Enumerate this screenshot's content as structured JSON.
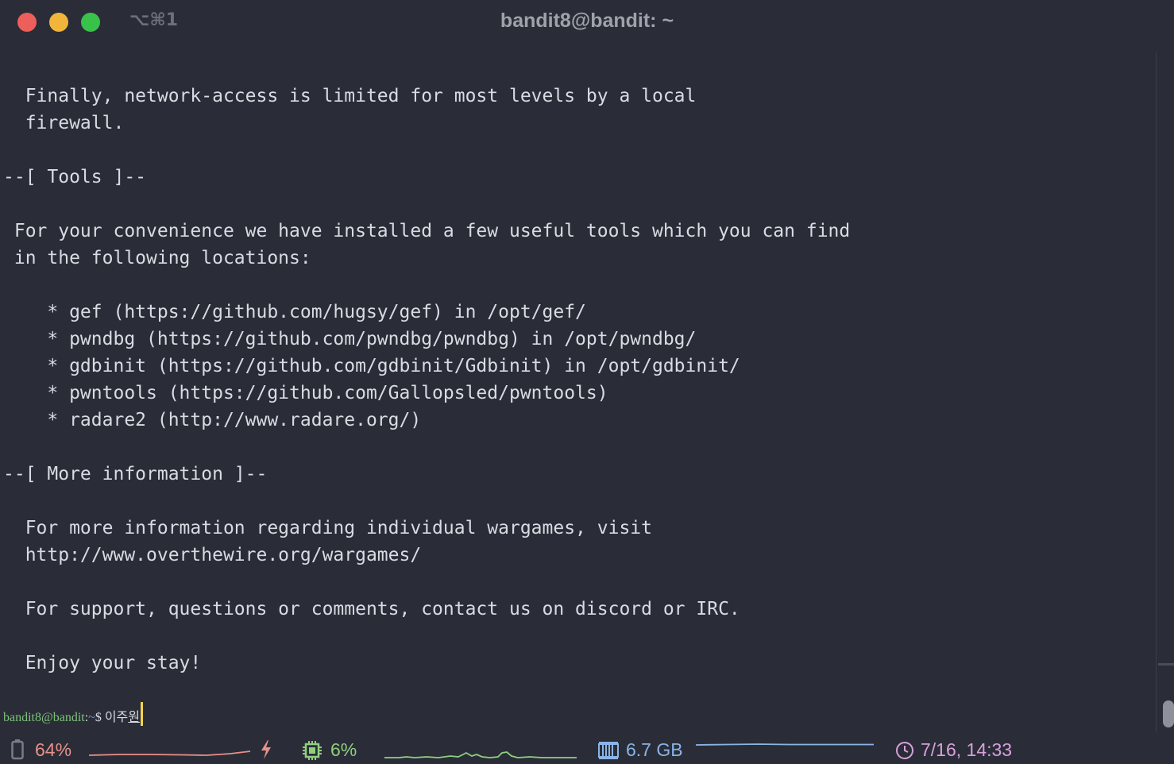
{
  "window": {
    "shortcut": "⌥⌘1",
    "title": "bandit8@bandit: ~"
  },
  "terminal": {
    "lines": [
      "",
      "  Finally, network-access is limited for most levels by a local",
      "  firewall.",
      "",
      "--[ Tools ]--",
      "",
      " For your convenience we have installed a few useful tools which you can find",
      " in the following locations:",
      "",
      "    * gef (https://github.com/hugsy/gef) in /opt/gef/",
      "    * pwndbg (https://github.com/pwndbg/pwndbg) in /opt/pwndbg/",
      "    * gdbinit (https://github.com/gdbinit/Gdbinit) in /opt/gdbinit/",
      "    * pwntools (https://github.com/Gallopsled/pwntools)",
      "    * radare2 (http://www.radare.org/)",
      "",
      "--[ More information ]--",
      "",
      "  For more information regarding individual wargames, visit",
      "  http://www.overthewire.org/wargames/",
      "",
      "  For support, questions or comments, contact us on discord or IRC.",
      "",
      "  Enjoy your stay!",
      ""
    ],
    "prompt": {
      "user_host": "bandit8@bandit",
      "separator": ":",
      "path": "~",
      "symbol": "$ ",
      "typed": "이주",
      "composing": "원"
    }
  },
  "statusbar": {
    "battery": {
      "icon": "battery-icon",
      "value": "64%",
      "color": "#e8908a",
      "charging_icon": "lightning-icon"
    },
    "cpu": {
      "icon": "cpu-icon",
      "value": "6%",
      "color": "#8fcf7f"
    },
    "memory": {
      "icon": "memory-icon",
      "value": "6.7 GB",
      "color": "#8ab4e8"
    },
    "clock": {
      "icon": "clock-icon",
      "value": "7/16, 14:33",
      "color": "#d8a0dc"
    }
  }
}
